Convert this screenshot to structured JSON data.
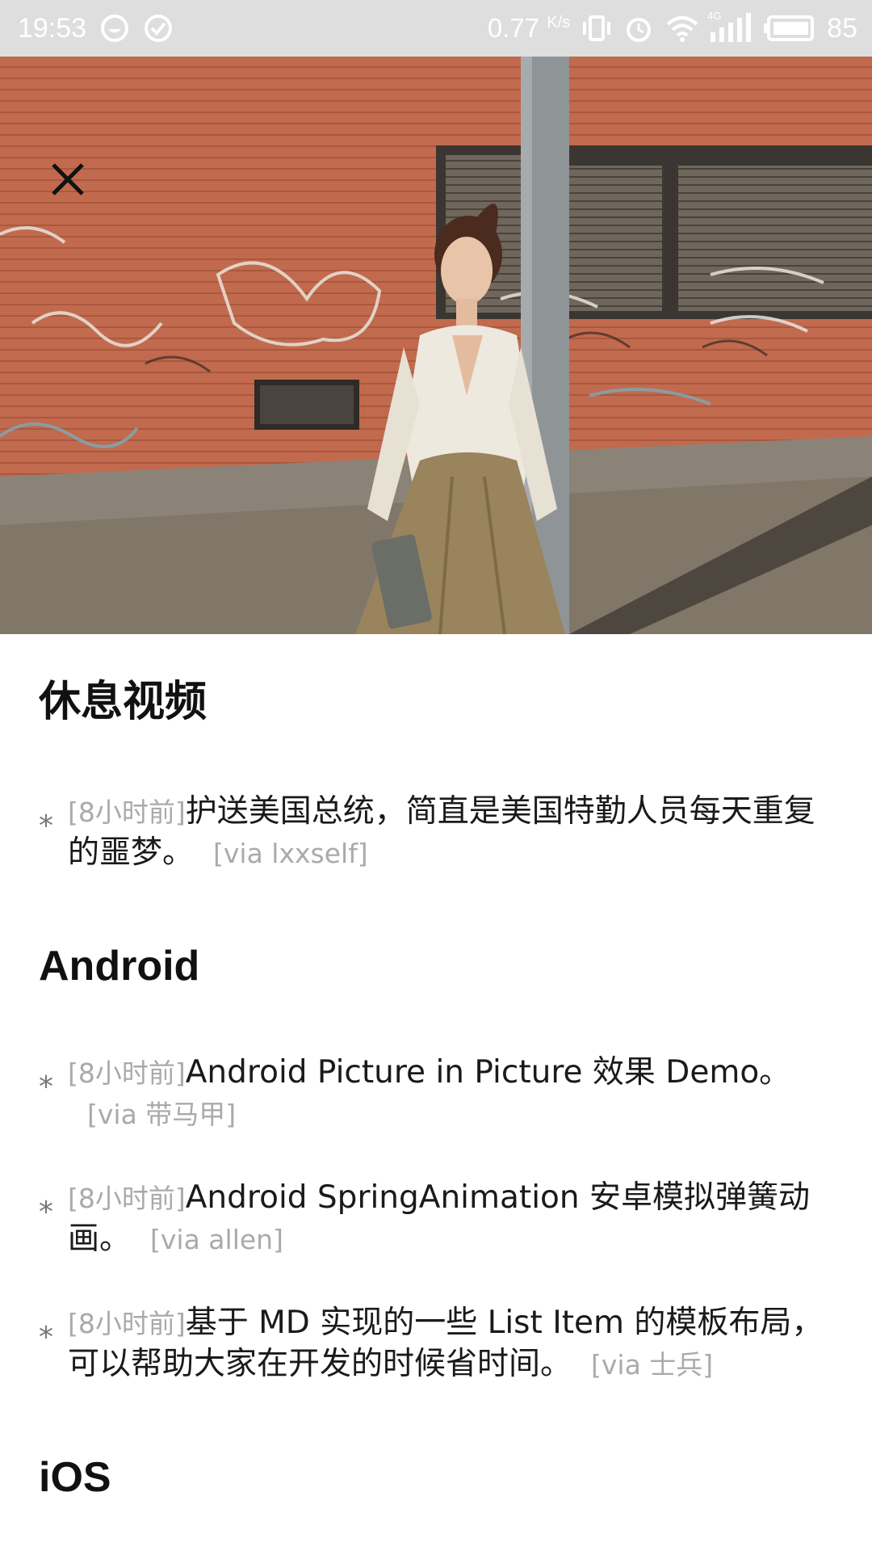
{
  "status_bar": {
    "time": "19:53",
    "net_speed": "0.77",
    "net_unit": "K/s",
    "network_type": "4G",
    "battery": "85",
    "icons": [
      "notification-smile-icon",
      "check-circle-icon",
      "vibrate-icon",
      "alarm-icon",
      "wifi-icon",
      "signal-icon",
      "battery-icon"
    ]
  },
  "hero": {
    "close_icon": "close-icon"
  },
  "sections": [
    {
      "title": "休息视频",
      "items": [
        {
          "time": "[8小时前]",
          "text": "护送美国总统，简直是美国特勤人员每天重复的噩梦。",
          "via": "[via lxxself]"
        }
      ]
    },
    {
      "title": "Android",
      "items": [
        {
          "time": "[8小时前]",
          "text": "Android Picture in Picture 效果 Demo。",
          "via": "[via 带马甲]"
        },
        {
          "time": "[8小时前]",
          "text": "Android SpringAnimation 安卓模拟弹簧动画。",
          "via": "[via allen]"
        },
        {
          "time": "[8小时前]",
          "text": "基于 MD 实现的一些 List Item 的模板布局，可以帮助大家在开发的时候省时间。",
          "via": "[via 士兵]"
        }
      ]
    },
    {
      "title": "iOS",
      "items": []
    }
  ],
  "bullet_char": "*"
}
